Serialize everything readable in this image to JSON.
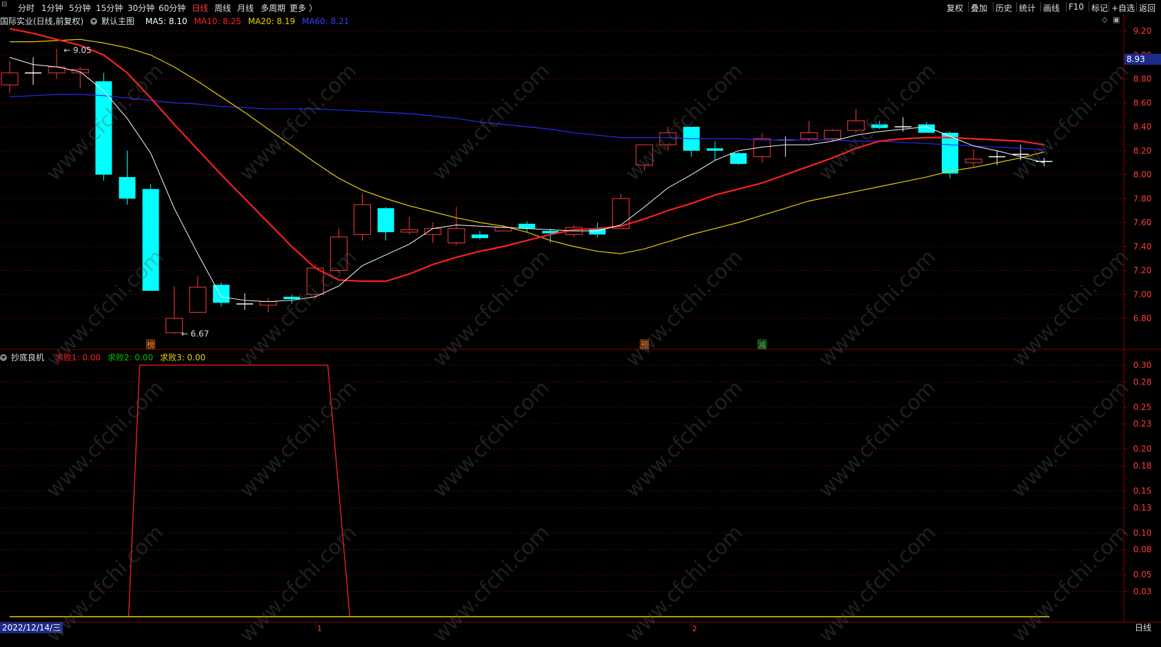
{
  "toolbar": {
    "periods": [
      "分时",
      "1分钟",
      "5分钟",
      "15分钟",
      "30分钟",
      "60分钟",
      "日线",
      "周线",
      "月线",
      "多周期",
      "更多 〉"
    ],
    "active_period": "日线",
    "right_items": [
      "复权",
      "叠加",
      "历史",
      "统计",
      "画线",
      "F10",
      "标记",
      "+自选",
      "返回"
    ]
  },
  "main_title": {
    "stock": "国际实业(日线,前复权)",
    "template": "默认主图",
    "ma5": "MA5: 8.10",
    "ma10": "MA10: 8.25",
    "ma20": "MA20: 8.19",
    "ma60": "MA60: 8.21"
  },
  "sub_title": {
    "name": "抄底良机",
    "s1": "求败1: 0.00",
    "s2": "求败2: 0.00",
    "s3": "求败3: 0.00"
  },
  "colors": {
    "up": "#ff3b3b",
    "down": "#00ffff",
    "ma5": "#ffffff",
    "ma10": "#ff2020",
    "ma20": "#e6d200",
    "ma60": "#2a2aff",
    "grid": "#5a0000"
  },
  "footer": {
    "date": "2022/12/14/三",
    "period": "日线",
    "month_marks": [
      "1",
      "2"
    ]
  },
  "last_price": "8.93",
  "watermark": "www.cfchi.com",
  "chart_data": [
    {
      "type": "candlestick",
      "ylim": [
        6.6,
        9.3
      ],
      "y_ticks": [
        "9.20",
        "9.00",
        "8.80",
        "8.60",
        "8.40",
        "8.20",
        "8.00",
        "7.80",
        "7.60",
        "7.40",
        "7.20",
        "7.00",
        "6.80"
      ],
      "ohlc": [
        [
          8.75,
          8.95,
          8.68,
          8.85
        ],
        [
          8.85,
          8.98,
          8.75,
          8.85
        ],
        [
          8.85,
          9.05,
          8.8,
          8.9
        ],
        [
          8.85,
          8.9,
          8.72,
          8.88
        ],
        [
          8.78,
          8.85,
          7.95,
          8.0
        ],
        [
          7.98,
          8.2,
          7.75,
          7.8
        ],
        [
          7.88,
          7.92,
          7.05,
          7.03
        ],
        [
          6.68,
          7.07,
          6.67,
          6.8
        ],
        [
          6.85,
          7.15,
          6.85,
          7.06
        ],
        [
          7.08,
          7.1,
          6.9,
          6.93
        ],
        [
          6.92,
          7.01,
          6.87,
          6.92
        ],
        [
          6.91,
          6.97,
          6.85,
          6.94
        ],
        [
          6.98,
          7.0,
          6.92,
          6.96
        ],
        [
          7.0,
          7.25,
          6.97,
          7.22
        ],
        [
          7.2,
          7.55,
          7.18,
          7.48
        ],
        [
          7.5,
          7.84,
          7.45,
          7.75
        ],
        [
          7.72,
          7.73,
          7.45,
          7.52
        ],
        [
          7.52,
          7.65,
          7.5,
          7.54
        ],
        [
          7.5,
          7.6,
          7.43,
          7.55
        ],
        [
          7.43,
          7.73,
          7.41,
          7.55
        ],
        [
          7.5,
          7.53,
          7.46,
          7.47
        ],
        [
          7.53,
          7.58,
          7.53,
          7.56
        ],
        [
          7.59,
          7.61,
          7.52,
          7.55
        ],
        [
          7.53,
          7.55,
          7.43,
          7.51
        ],
        [
          7.5,
          7.58,
          7.48,
          7.56
        ],
        [
          7.55,
          7.6,
          7.48,
          7.5
        ],
        [
          7.55,
          7.84,
          7.55,
          7.8
        ],
        [
          8.08,
          8.25,
          8.03,
          8.25
        ],
        [
          8.25,
          8.4,
          8.2,
          8.35
        ],
        [
          8.4,
          8.4,
          8.15,
          8.2
        ],
        [
          8.22,
          8.28,
          8.12,
          8.2
        ],
        [
          8.18,
          8.19,
          8.08,
          8.09
        ],
        [
          8.15,
          8.35,
          8.1,
          8.3
        ],
        [
          8.28,
          8.32,
          8.15,
          8.29
        ],
        [
          8.3,
          8.45,
          8.28,
          8.35
        ],
        [
          8.3,
          8.38,
          8.28,
          8.37
        ],
        [
          8.37,
          8.55,
          8.35,
          8.45
        ],
        [
          8.42,
          8.45,
          8.38,
          8.39
        ],
        [
          8.4,
          8.48,
          8.36,
          8.4
        ],
        [
          8.42,
          8.44,
          8.35,
          8.35
        ],
        [
          8.35,
          8.36,
          7.97,
          8.01
        ],
        [
          8.1,
          8.21,
          8.06,
          8.13
        ],
        [
          8.15,
          8.2,
          8.08,
          8.15
        ],
        [
          8.17,
          8.25,
          8.12,
          8.17
        ],
        [
          8.12,
          8.14,
          8.07,
          8.11
        ]
      ],
      "ma5": [
        8.98,
        8.92,
        8.9,
        8.86,
        8.7,
        8.47,
        8.18,
        7.72,
        7.34,
        6.98,
        6.95,
        6.94,
        6.95,
        6.98,
        7.07,
        7.24,
        7.33,
        7.42,
        7.55,
        7.58,
        7.57,
        7.56,
        7.55,
        7.54,
        7.53,
        7.53,
        7.58,
        7.73,
        7.89,
        8.0,
        8.12,
        8.2,
        8.23,
        8.25,
        8.25,
        8.28,
        8.33,
        8.36,
        8.38,
        8.4,
        8.32,
        8.24,
        8.2,
        8.15,
        8.1
      ],
      "ma10": [
        9.22,
        9.18,
        9.13,
        9.08,
        9.0,
        8.85,
        8.64,
        8.42,
        8.21,
        8.0,
        7.8,
        7.6,
        7.4,
        7.22,
        7.12,
        7.11,
        7.11,
        7.17,
        7.25,
        7.31,
        7.36,
        7.4,
        7.45,
        7.5,
        7.54,
        7.55,
        7.57,
        7.63,
        7.7,
        7.76,
        7.83,
        7.88,
        7.93,
        8.0,
        8.07,
        8.14,
        8.22,
        8.28,
        8.3,
        8.31,
        8.31,
        8.3,
        8.29,
        8.28,
        8.25
      ],
      "ma20": [
        9.11,
        9.11,
        9.12,
        9.13,
        9.1,
        9.06,
        9.0,
        8.9,
        8.78,
        8.65,
        8.52,
        8.38,
        8.24,
        8.1,
        7.97,
        7.87,
        7.8,
        7.74,
        7.69,
        7.64,
        7.6,
        7.57,
        7.52,
        7.45,
        7.4,
        7.36,
        7.34,
        7.38,
        7.44,
        7.5,
        7.55,
        7.6,
        7.66,
        7.72,
        7.78,
        7.82,
        7.86,
        7.9,
        7.94,
        7.98,
        8.03,
        8.06,
        8.1,
        8.14,
        8.19
      ],
      "ma60": [
        8.65,
        8.66,
        8.67,
        8.67,
        8.66,
        8.64,
        8.62,
        8.6,
        8.59,
        8.57,
        8.56,
        8.55,
        8.55,
        8.55,
        8.54,
        8.53,
        8.52,
        8.51,
        8.49,
        8.47,
        8.44,
        8.42,
        8.4,
        8.38,
        8.35,
        8.33,
        8.31,
        8.31,
        8.31,
        8.3,
        8.3,
        8.3,
        8.29,
        8.29,
        8.29,
        8.29,
        8.28,
        8.28,
        8.27,
        8.26,
        8.25,
        8.24,
        8.23,
        8.22,
        8.21
      ],
      "annotations": [
        {
          "index": 2,
          "price": 9.05,
          "text": "9.05"
        },
        {
          "index": 7,
          "price": 6.67,
          "text": "6.67"
        }
      ],
      "signals": [
        {
          "index": 6,
          "text": "榜",
          "color": "#ff8a3a"
        },
        {
          "index": 27,
          "text": "预",
          "color": "#ff8a3a"
        },
        {
          "index": 32,
          "text": "減",
          "color": "#00e060"
        }
      ]
    },
    {
      "type": "line",
      "name": "抄底良机",
      "ylim": [
        0,
        0.32
      ],
      "y_ticks": [
        "0.30",
        "0.28",
        "0.25",
        "0.23",
        "0.20",
        "0.18",
        "0.15",
        "0.13",
        "0.10",
        "0.08",
        "0.05",
        "0.03"
      ],
      "series": [
        {
          "name": "求败1",
          "color": "#ff2020",
          "values": [
            0,
            0,
            0,
            0,
            0,
            0,
            0.3,
            0.3,
            0.3,
            0.3,
            0.3,
            0.3,
            0.3,
            0.3,
            0.3,
            0,
            0,
            0,
            0,
            0,
            0,
            0,
            0,
            0,
            0,
            0,
            0,
            0,
            0,
            0,
            0,
            0,
            0,
            0,
            0,
            0,
            0,
            0,
            0,
            0,
            0,
            0,
            0,
            0,
            0
          ]
        },
        {
          "name": "求败3",
          "color": "#e6d200",
          "values": [
            0,
            0,
            0,
            0,
            0,
            0,
            0,
            0,
            0,
            0,
            0,
            0,
            0,
            0,
            0,
            0,
            0,
            0,
            0,
            0,
            0,
            0,
            0,
            0,
            0,
            0,
            0,
            0,
            0,
            0,
            0,
            0,
            0,
            0,
            0,
            0,
            0,
            0,
            0,
            0,
            0,
            0,
            0,
            0,
            0
          ]
        }
      ]
    }
  ]
}
